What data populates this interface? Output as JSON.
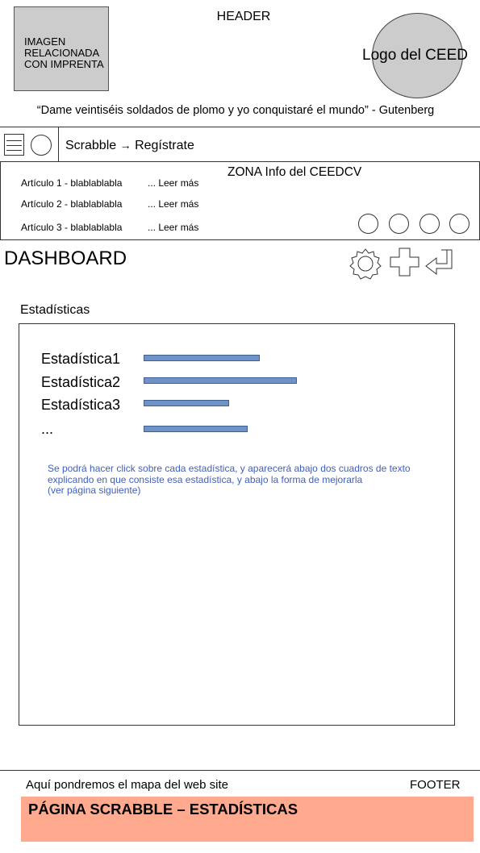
{
  "header": {
    "label": "HEADER",
    "image_placeholder_lines": [
      "IMAGEN",
      "RELACIONADA",
      "CON IMPRENTA"
    ],
    "logo_text": "Logo del CEED",
    "quote": "“Dame veintiséis soldados de plomo y yo conquistaré el mundo”  - Gutenberg"
  },
  "nav": {
    "breadcrumb_current": "Scrabble",
    "breadcrumb_arrow": "→",
    "breadcrumb_next": "Regístrate"
  },
  "info_zone": {
    "title": "ZONA Info del CEEDCV",
    "articles": [
      {
        "title": "Artículo 1 - blablablabla",
        "more": "... Leer más"
      },
      {
        "title": "Artículo 2 - blablablabla",
        "more": "... Leer más"
      },
      {
        "title": "Artículo 3 - blablablabla",
        "more": "... Leer más"
      }
    ]
  },
  "dashboard": {
    "title": "DASHBOARD",
    "icons": [
      "gear-icon",
      "plus-icon",
      "enter-icon"
    ]
  },
  "stats": {
    "section_label": "Estadísticas",
    "items": [
      {
        "label": "Estadística1",
        "value": 0.38
      },
      {
        "label": "Estadística2",
        "value": 0.5
      },
      {
        "label": "Estadística3",
        "value": 0.28
      },
      {
        "label": "...",
        "value": 0.34
      }
    ],
    "note_lines": [
      "Se podrá hacer click sobre cada estadística, y aparecerá abajo dos cuadros de texto",
      "explicando en que consiste esa estadística, y abajo la forma de mejorarla",
      " (ver página siguiente)"
    ],
    "bar_color": "#6f93c6"
  },
  "footer": {
    "sitemap_text": "Aquí pondremos el mapa del web site",
    "label": "FOOTER",
    "page_title": "PÁGINA SCRABBLE – ESTADÍSTICAS",
    "banner_color": "#ffa98f"
  }
}
